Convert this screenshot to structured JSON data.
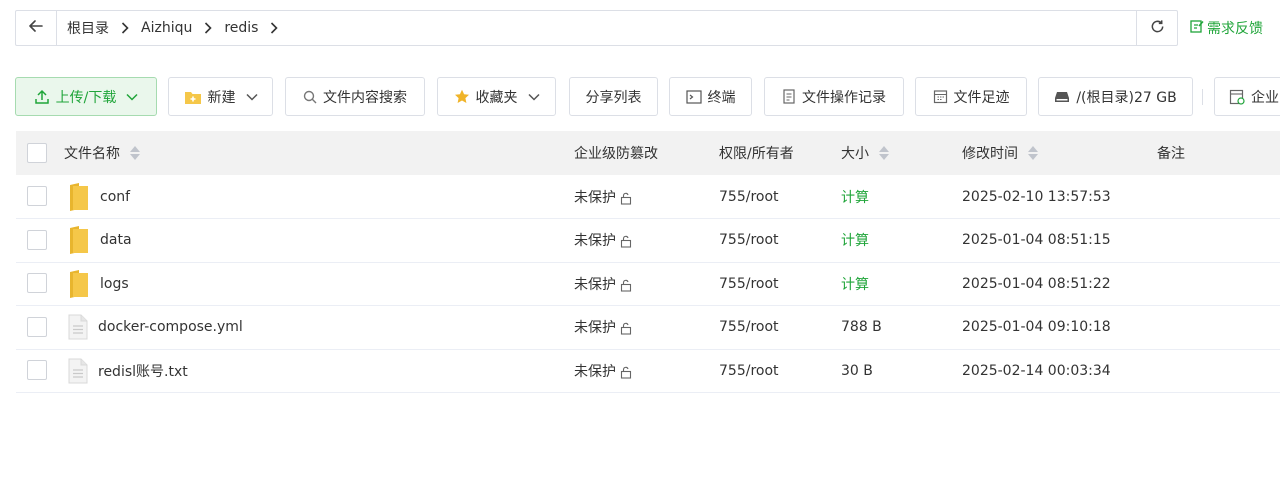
{
  "path": {
    "crumbs": [
      "根目录",
      "Aizhiqu",
      "redis"
    ]
  },
  "feedback_label": "需求反馈",
  "toolbar": {
    "upload_label": "上传/下载",
    "new_label": "新建",
    "search_label": "文件内容搜索",
    "favorites_label": "收藏夹",
    "share_label": "分享列表",
    "terminal_label": "终端",
    "oplog_label": "文件操作记录",
    "footprint_label": "文件足迹",
    "disk_label": "/(根目录)27 GB",
    "enterprise_label": "企业"
  },
  "table": {
    "headers": {
      "name": "文件名称",
      "tamper": "企业级防篡改",
      "perm": "权限/所有者",
      "size": "大小",
      "mtime": "修改时间",
      "note": "备注"
    },
    "rows": [
      {
        "type": "folder",
        "name": "conf",
        "tamper": "未保护",
        "perm": "755/root",
        "size": "计算",
        "size_link": true,
        "mtime": "2025-02-10 13:57:53",
        "note": ""
      },
      {
        "type": "folder",
        "name": "data",
        "tamper": "未保护",
        "perm": "755/root",
        "size": "计算",
        "size_link": true,
        "mtime": "2025-01-04 08:51:15",
        "note": ""
      },
      {
        "type": "folder",
        "name": "logs",
        "tamper": "未保护",
        "perm": "755/root",
        "size": "计算",
        "size_link": true,
        "mtime": "2025-01-04 08:51:22",
        "note": ""
      },
      {
        "type": "file",
        "name": "docker-compose.yml",
        "tamper": "未保护",
        "perm": "755/root",
        "size": "788 B",
        "size_link": false,
        "mtime": "2025-01-04 09:10:18",
        "note": ""
      },
      {
        "type": "file",
        "name": "redisl账号.txt",
        "tamper": "未保护",
        "perm": "755/root",
        "size": "30 B",
        "size_link": false,
        "mtime": "2025-02-14 00:03:34",
        "note": ""
      }
    ]
  },
  "colors": {
    "accent": "#20a53a",
    "folder": "#f5c749",
    "header_bg": "#f2f2f2"
  }
}
